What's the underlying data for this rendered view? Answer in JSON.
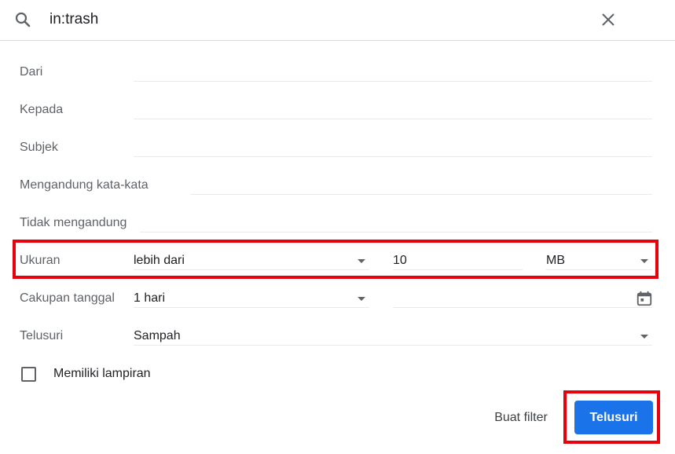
{
  "search": {
    "query": "in:trash",
    "icon": "search-icon",
    "close_icon": "close-icon"
  },
  "fields": {
    "from_label": "Dari",
    "to_label": "Kepada",
    "subject_label": "Subjek",
    "has_words_label": "Mengandung kata-kata",
    "not_has_label": "Tidak mengandung",
    "size_label": "Ukuran",
    "size_operator": "lebih dari",
    "size_value": "10",
    "size_unit": "MB",
    "date_range_label": "Cakupan tanggal",
    "date_range_value": "1 hari",
    "search_in_label": "Telusuri",
    "search_in_value": "Sampah",
    "has_attachment_label": "Memiliki lampiran"
  },
  "actions": {
    "create_filter": "Buat filter",
    "search": "Telusuri"
  },
  "colors": {
    "primary": "#1a73e8",
    "highlight": "#e8000d"
  }
}
